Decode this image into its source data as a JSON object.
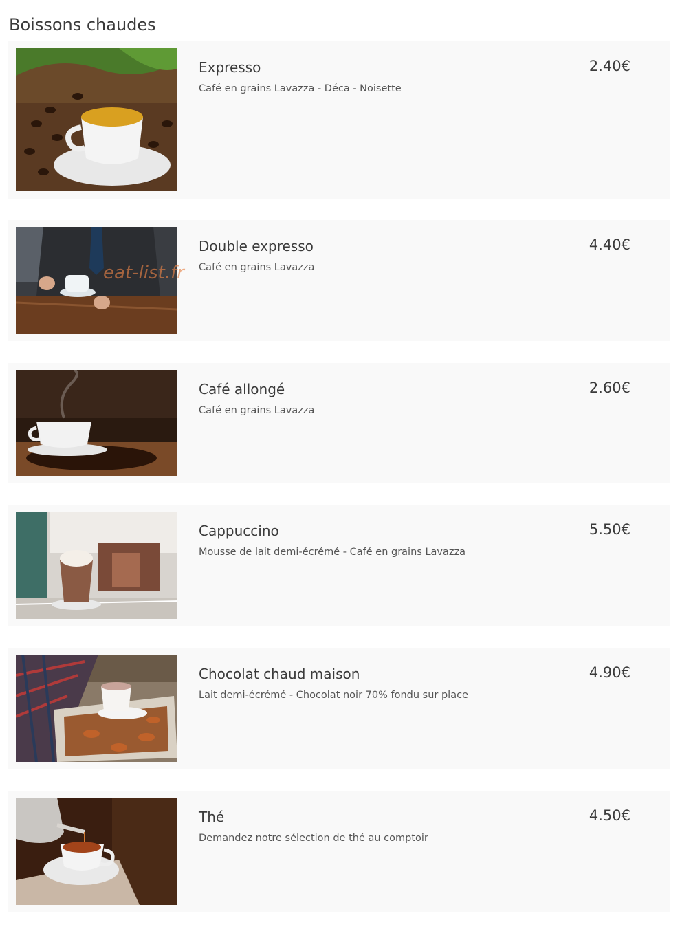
{
  "section": {
    "title": "Boissons chaudes"
  },
  "watermark": "eat-list.fr",
  "items": [
    {
      "name": "Expresso",
      "description": "Café en grains Lavazza - Déca - Noisette",
      "price": "2.40€"
    },
    {
      "name": "Double expresso",
      "description": "Café en grains Lavazza",
      "price": "4.40€"
    },
    {
      "name": "Café allongé",
      "description": "Café en grains Lavazza",
      "price": "2.60€"
    },
    {
      "name": "Cappuccino",
      "description": "Mousse de lait demi-écrémé - Café en grains Lavazza",
      "price": "5.50€"
    },
    {
      "name": "Chocolat chaud maison",
      "description": "Lait demi-écrémé - Chocolat noir 70% fondu sur place",
      "price": "4.90€"
    },
    {
      "name": "Thé",
      "description": "Demandez notre sélection de thé au comptoir",
      "price": "4.50€"
    }
  ]
}
